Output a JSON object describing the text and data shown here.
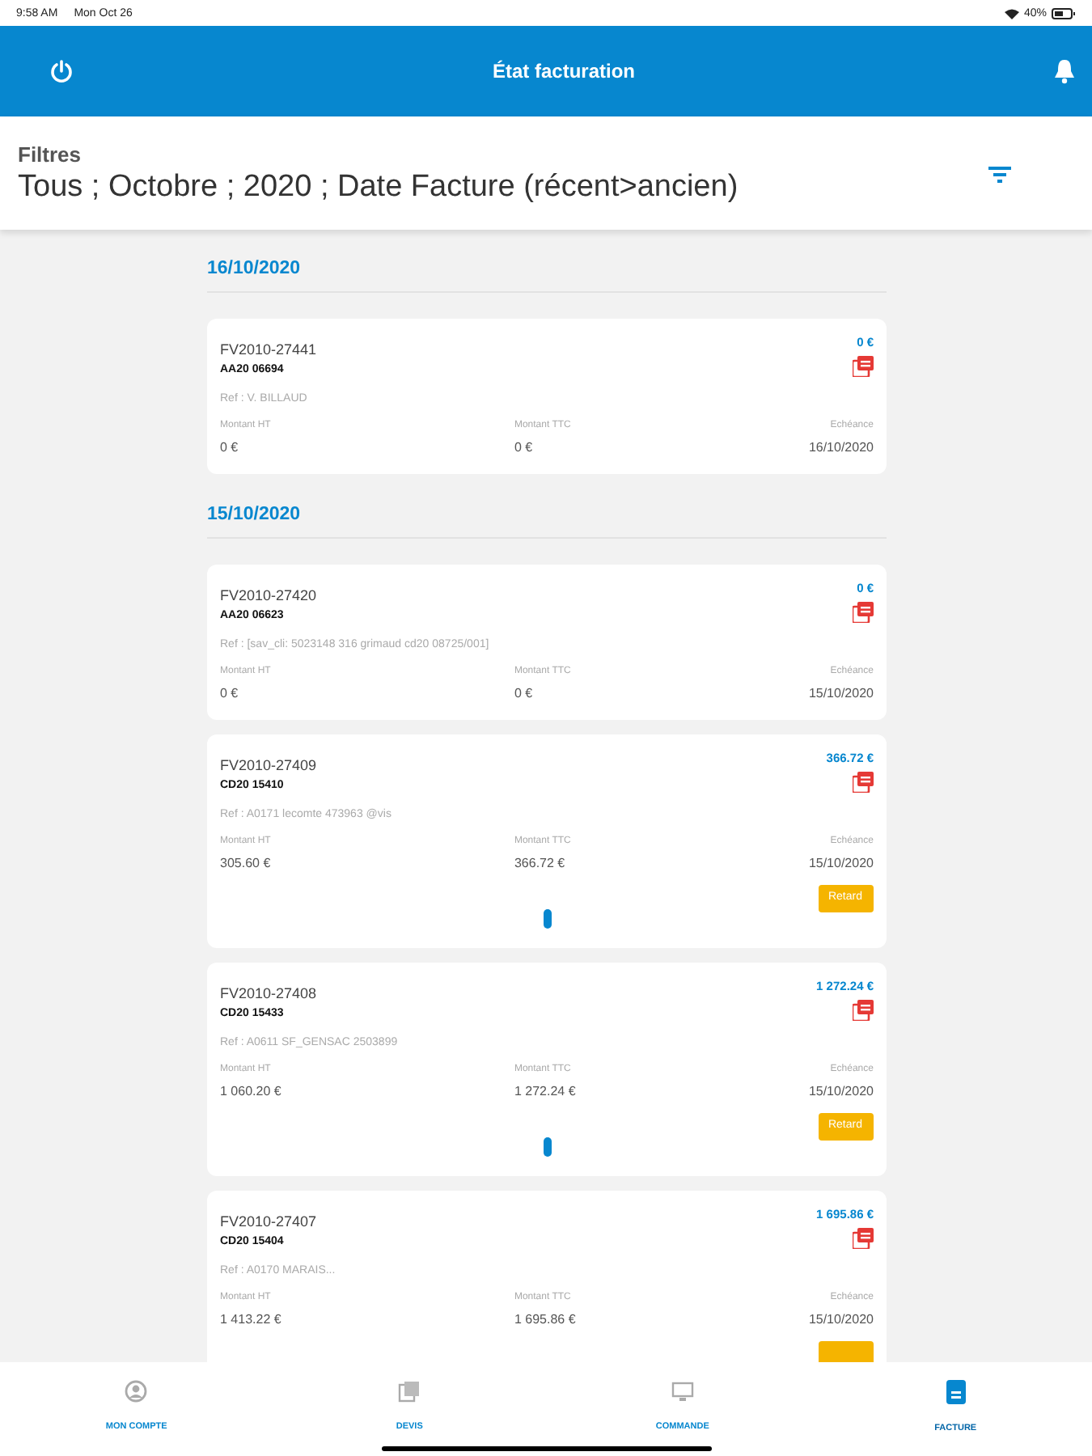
{
  "status_bar": {
    "time": "9:58 AM",
    "date": "Mon Oct 26",
    "battery": "40%"
  },
  "header": {
    "title": "État facturation"
  },
  "filters": {
    "label": "Filtres",
    "value": "Tous ; Octobre ; 2020 ; Date Facture (récent>ancien)"
  },
  "sections": [
    {
      "date": "16/10/2020",
      "invoices": [
        {
          "number": "FV2010-27441",
          "code": "AA20 06694",
          "ref": "Ref : V. BILLAUD",
          "total": "0 €",
          "ht_label": "Montant HT",
          "ht": "0 €",
          "ttc_label": "Montant TTC",
          "ttc": "0 €",
          "due_label": "Echéance",
          "due": "16/10/2020",
          "late": false,
          "has_details": false
        }
      ]
    },
    {
      "date": "15/10/2020",
      "invoices": [
        {
          "number": "FV2010-27420",
          "code": "AA20 06623",
          "ref": "Ref : [sav_cli: 5023148 316 grimaud cd20 08725/001]",
          "total": "0 €",
          "ht_label": "Montant HT",
          "ht": "0 €",
          "ttc_label": "Montant TTC",
          "ttc": "0 €",
          "due_label": "Echéance",
          "due": "15/10/2020",
          "late": false,
          "has_details": false
        },
        {
          "number": "FV2010-27409",
          "code": "CD20 15410",
          "ref": "Ref : A0171 lecomte 473963 @vis",
          "total": "366.72 €",
          "ht_label": "Montant HT",
          "ht": "305.60 €",
          "ttc_label": "Montant TTC",
          "ttc": "366.72 €",
          "due_label": "Echéance",
          "due": "15/10/2020",
          "late": true,
          "badge": "Retard",
          "has_details": true
        },
        {
          "number": "FV2010-27408",
          "code": "CD20 15433",
          "ref": "Ref : A0611 SF_GENSAC 2503899",
          "total": "1 272.24 €",
          "ht_label": "Montant HT",
          "ht": "1 060.20 €",
          "ttc_label": "Montant TTC",
          "ttc": "1 272.24 €",
          "due_label": "Echéance",
          "due": "15/10/2020",
          "late": true,
          "badge": "Retard",
          "has_details": true
        },
        {
          "number": "FV2010-27407",
          "code": "CD20 15404",
          "ref": "Ref : A0170 MARAIS...",
          "total": "1 695.86 €",
          "ht_label": "Montant HT",
          "ht": "1 413.22 €",
          "ttc_label": "Montant TTC",
          "ttc": "1 695.86 €",
          "due_label": "Echéance",
          "due": "15/10/2020",
          "late": true,
          "has_details": false
        }
      ]
    }
  ],
  "tabs": [
    {
      "kind": "account",
      "label": "MON COMPTE",
      "selected": false
    },
    {
      "kind": "quotes",
      "label": "DEVIS",
      "selected": false
    },
    {
      "kind": "orders",
      "label": "COMMANDE",
      "selected": false
    },
    {
      "kind": "invoice",
      "label": "FACTURE",
      "selected": true
    }
  ]
}
